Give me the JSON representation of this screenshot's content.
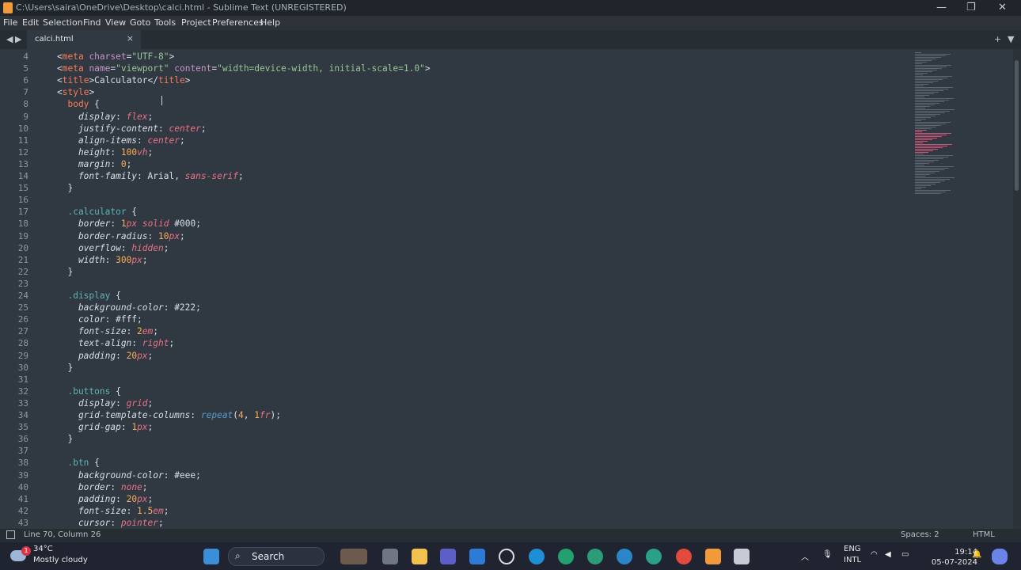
{
  "window": {
    "title": "C:\\Users\\saira\\OneDrive\\Desktop\\calci.html - Sublime Text (UNREGISTERED)",
    "minimize": "—",
    "restore": "❐",
    "close": "✕"
  },
  "menu": [
    "File",
    "Edit",
    "Selection",
    "Find",
    "View",
    "Goto",
    "Tools",
    "Project",
    "Preferences",
    "Help"
  ],
  "tabs": {
    "nav_left": "◀",
    "nav_right": "▶",
    "active_tab": "calci.html",
    "close_icon": "×",
    "new_tab": "+",
    "tab_menu": "▼"
  },
  "editor": {
    "line_numbers": [
      "4",
      "5",
      "6",
      "7",
      "8",
      "9",
      "10",
      "11",
      "12",
      "13",
      "14",
      "15",
      "16",
      "17",
      "18",
      "19",
      "20",
      "21",
      "22",
      "23",
      "24",
      "25",
      "26",
      "27",
      "28",
      "29",
      "30",
      "31",
      "32",
      "33",
      "34",
      "35",
      "36",
      "37",
      "38",
      "39",
      "40",
      "41",
      "42",
      "43"
    ],
    "lines": [
      [
        [
          "p",
          "<"
        ],
        [
          "t",
          "meta"
        ],
        [
          "a",
          " charset"
        ],
        [
          "p",
          "="
        ],
        [
          "s",
          "\"UTF-8\""
        ],
        [
          "p",
          ">"
        ]
      ],
      [
        [
          "p",
          "<"
        ],
        [
          "t",
          "meta"
        ],
        [
          "a",
          " name"
        ],
        [
          "p",
          "="
        ],
        [
          "s",
          "\"viewport\""
        ],
        [
          "a",
          " content"
        ],
        [
          "p",
          "="
        ],
        [
          "s",
          "\"width=device-width, initial-scale=1.0\""
        ],
        [
          "p",
          ">"
        ]
      ],
      [
        [
          "p",
          "<"
        ],
        [
          "t",
          "title"
        ],
        [
          "p",
          ">Calculator</"
        ],
        [
          "t",
          "title"
        ],
        [
          "p",
          ">"
        ]
      ],
      [
        [
          "p",
          "<"
        ],
        [
          "t",
          "style"
        ],
        [
          "p",
          ">"
        ]
      ],
      [
        [
          "sel",
          "  body"
        ],
        [
          "p",
          " {"
        ]
      ],
      [
        [
          "i",
          "    display"
        ],
        [
          "p",
          ": "
        ],
        [
          "v",
          "flex"
        ],
        [
          "p",
          ";"
        ]
      ],
      [
        [
          "i",
          "    justify-content"
        ],
        [
          "p",
          ": "
        ],
        [
          "v",
          "center"
        ],
        [
          "p",
          ";"
        ]
      ],
      [
        [
          "i",
          "    align-items"
        ],
        [
          "p",
          ": "
        ],
        [
          "v",
          "center"
        ],
        [
          "p",
          ";"
        ]
      ],
      [
        [
          "i",
          "    height"
        ],
        [
          "p",
          ": "
        ],
        [
          "n",
          "100"
        ],
        [
          "v",
          "vh"
        ],
        [
          "p",
          ";"
        ]
      ],
      [
        [
          "i",
          "    margin"
        ],
        [
          "p",
          ": "
        ],
        [
          "n",
          "0"
        ],
        [
          "p",
          ";"
        ]
      ],
      [
        [
          "i",
          "    font-family"
        ],
        [
          "p",
          ": Arial, "
        ],
        [
          "v",
          "sans-serif"
        ],
        [
          "p",
          ";"
        ]
      ],
      [
        [
          "p",
          "  }"
        ]
      ],
      [
        [
          "p",
          ""
        ]
      ],
      [
        [
          "k",
          "  .calculator"
        ],
        [
          "p",
          " {"
        ]
      ],
      [
        [
          "i",
          "    border"
        ],
        [
          "p",
          ": "
        ],
        [
          "n",
          "1"
        ],
        [
          "v",
          "px"
        ],
        [
          "p",
          " "
        ],
        [
          "v",
          "solid"
        ],
        [
          "p",
          " "
        ],
        [
          "p",
          "#000"
        ],
        [
          "p",
          ";"
        ]
      ],
      [
        [
          "i",
          "    border-radius"
        ],
        [
          "p",
          ": "
        ],
        [
          "n",
          "10"
        ],
        [
          "v",
          "px"
        ],
        [
          "p",
          ";"
        ]
      ],
      [
        [
          "i",
          "    overflow"
        ],
        [
          "p",
          ": "
        ],
        [
          "v",
          "hidden"
        ],
        [
          "p",
          ";"
        ]
      ],
      [
        [
          "i",
          "    width"
        ],
        [
          "p",
          ": "
        ],
        [
          "n",
          "300"
        ],
        [
          "v",
          "px"
        ],
        [
          "p",
          ";"
        ]
      ],
      [
        [
          "p",
          "  }"
        ]
      ],
      [
        [
          "p",
          ""
        ]
      ],
      [
        [
          "k",
          "  .display"
        ],
        [
          "p",
          " {"
        ]
      ],
      [
        [
          "i",
          "    background-color"
        ],
        [
          "p",
          ": #222;"
        ]
      ],
      [
        [
          "i",
          "    color"
        ],
        [
          "p",
          ": #fff;"
        ]
      ],
      [
        [
          "i",
          "    font-size"
        ],
        [
          "p",
          ": "
        ],
        [
          "n",
          "2"
        ],
        [
          "v",
          "em"
        ],
        [
          "p",
          ";"
        ]
      ],
      [
        [
          "i",
          "    text-align"
        ],
        [
          "p",
          ": "
        ],
        [
          "v",
          "right"
        ],
        [
          "p",
          ";"
        ]
      ],
      [
        [
          "i",
          "    padding"
        ],
        [
          "p",
          ": "
        ],
        [
          "n",
          "20"
        ],
        [
          "v",
          "px"
        ],
        [
          "p",
          ";"
        ]
      ],
      [
        [
          "p",
          "  }"
        ]
      ],
      [
        [
          "p",
          ""
        ]
      ],
      [
        [
          "k",
          "  .buttons"
        ],
        [
          "p",
          " {"
        ]
      ],
      [
        [
          "i",
          "    display"
        ],
        [
          "p",
          ": "
        ],
        [
          "v",
          "grid"
        ],
        [
          "p",
          ";"
        ]
      ],
      [
        [
          "i",
          "    grid-template-columns"
        ],
        [
          "p",
          ": "
        ],
        [
          "f",
          "repeat"
        ],
        [
          "p",
          "("
        ],
        [
          "n",
          "4"
        ],
        [
          "p",
          ", "
        ],
        [
          "n",
          "1"
        ],
        [
          "v",
          "fr"
        ],
        [
          "p",
          ");"
        ]
      ],
      [
        [
          "i",
          "    grid-gap"
        ],
        [
          "p",
          ": "
        ],
        [
          "n",
          "1"
        ],
        [
          "v",
          "px"
        ],
        [
          "p",
          ";"
        ]
      ],
      [
        [
          "p",
          "  }"
        ]
      ],
      [
        [
          "p",
          ""
        ]
      ],
      [
        [
          "k",
          "  .btn"
        ],
        [
          "p",
          " {"
        ]
      ],
      [
        [
          "i",
          "    background-color"
        ],
        [
          "p",
          ": #eee;"
        ]
      ],
      [
        [
          "i",
          "    border"
        ],
        [
          "p",
          ": "
        ],
        [
          "v",
          "none"
        ],
        [
          "p",
          ";"
        ]
      ],
      [
        [
          "i",
          "    padding"
        ],
        [
          "p",
          ": "
        ],
        [
          "n",
          "20"
        ],
        [
          "v",
          "px"
        ],
        [
          "p",
          ";"
        ]
      ],
      [
        [
          "i",
          "    font-size"
        ],
        [
          "p",
          ": "
        ],
        [
          "n",
          "1.5"
        ],
        [
          "v",
          "em"
        ],
        [
          "p",
          ";"
        ]
      ],
      [
        [
          "i",
          "    cursor"
        ],
        [
          "p",
          ": "
        ],
        [
          "v",
          "pointer"
        ],
        [
          "p",
          ";"
        ]
      ]
    ]
  },
  "status": {
    "position": "Line 70, Column 26",
    "spaces": "Spaces: 2",
    "syntax": "HTML"
  },
  "taskbar": {
    "temperature": "34°C",
    "condition": "Mostly cloudy",
    "weather_badge": "1",
    "search_label": "Search",
    "language_line1": "ENG",
    "language_line2": "INTL",
    "time": "19:14",
    "date": "05-07-2024"
  },
  "colors": {
    "editor_bg": "#303841",
    "tag": "#f97b58",
    "attribute": "#c695c6",
    "string": "#99c794",
    "selector": "#5fb4b4",
    "value": "#ea7285",
    "number": "#f9ae58"
  }
}
